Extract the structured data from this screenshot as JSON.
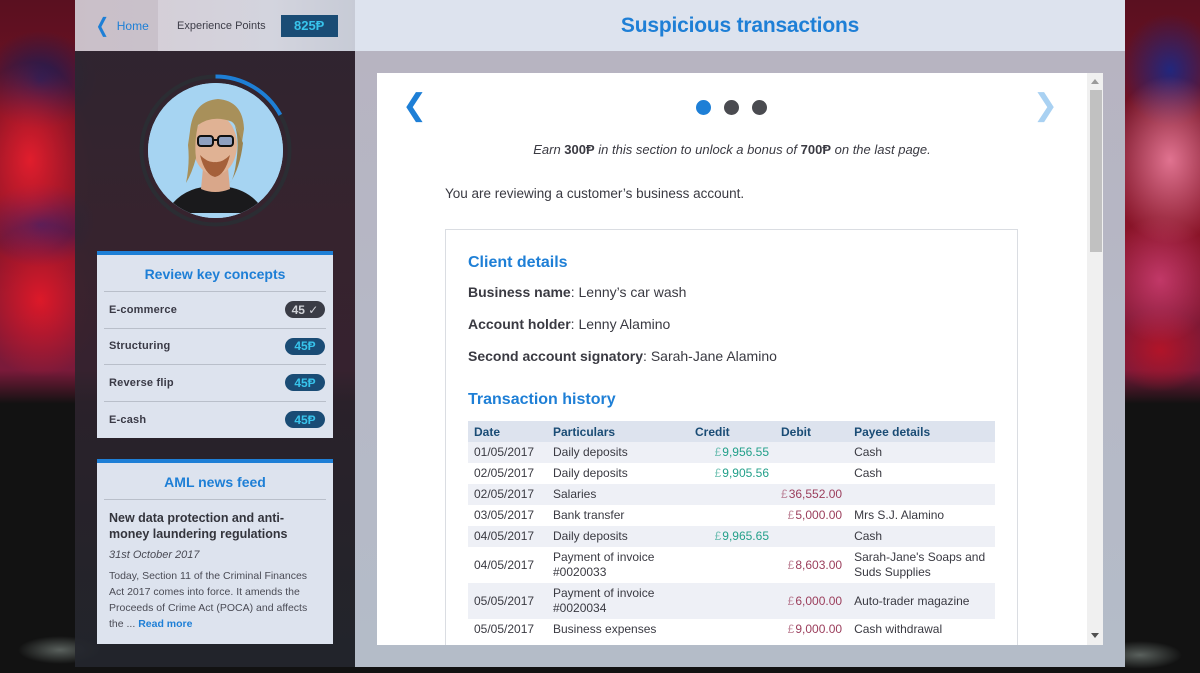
{
  "topbar": {
    "home_label": "Home",
    "xp_label": "Experience Points",
    "xp_value": "825Ᵽ"
  },
  "avatar": {
    "progress_fraction": 0.17,
    "progress_color": "#1e7fd6"
  },
  "key_concepts": {
    "title": "Review key concepts",
    "items": [
      {
        "label": "E-commerce",
        "badge": "45 ✓",
        "completed": true
      },
      {
        "label": "Structuring",
        "badge": "45Ᵽ",
        "completed": false
      },
      {
        "label": "Reverse flip",
        "badge": "45Ᵽ",
        "completed": false
      },
      {
        "label": "E-cash",
        "badge": "45Ᵽ",
        "completed": false
      }
    ]
  },
  "news_feed": {
    "title": "AML news feed",
    "article_title": "New data protection and anti-money laundering regulations",
    "date": "31st October 2017",
    "excerpt": "Today, Section 11 of the Criminal Finances Act 2017 comes into force. It amends the Proceeds of Crime Act (POCA) and affects the ... ",
    "read_more": "Read more"
  },
  "main": {
    "title": "Suspicious transactions",
    "pagination": {
      "total": 3,
      "current": 1
    },
    "earn_prefix": "Earn ",
    "earn_amount": "300Ᵽ",
    "earn_middle": " in this section to unlock a bonus of ",
    "bonus_amount": "700Ᵽ",
    "earn_suffix": " on the last page.",
    "intro": "You are reviewing a customer’s business account."
  },
  "client_details": {
    "heading": "Client details",
    "business_name_label": "Business name",
    "business_name": "Lenny’s car wash",
    "account_holder_label": "Account holder",
    "account_holder": "Lenny Alamino",
    "second_signatory_label": "Second account signatory",
    "second_signatory": "Sarah-Jane Alamino"
  },
  "transactions": {
    "heading": "Transaction history",
    "currency_symbol": "£",
    "columns": [
      "Date",
      "Particulars",
      "Credit",
      "Debit",
      "Payee details"
    ],
    "rows": [
      {
        "date": "01/05/2017",
        "particulars": "Daily deposits",
        "credit": "9,956.55",
        "debit": "",
        "payee": "Cash"
      },
      {
        "date": "02/05/2017",
        "particulars": "Daily deposits",
        "credit": "9,905.56",
        "debit": "",
        "payee": "Cash"
      },
      {
        "date": "02/05/2017",
        "particulars": "Salaries",
        "credit": "",
        "debit": "36,552.00",
        "payee": ""
      },
      {
        "date": "03/05/2017",
        "particulars": "Bank transfer",
        "credit": "",
        "debit": "5,000.00",
        "payee": "Mrs S.J. Alamino"
      },
      {
        "date": "04/05/2017",
        "particulars": "Daily deposits",
        "credit": "9,965.65",
        "debit": "",
        "payee": "Cash"
      },
      {
        "date": "04/05/2017",
        "particulars": "Payment of invoice #0020033",
        "credit": "",
        "debit": "8,603.00",
        "payee": "Sarah-Jane's Soaps and Suds Supplies"
      },
      {
        "date": "05/05/2017",
        "particulars": "Payment of invoice #0020034",
        "credit": "",
        "debit": "6,000.00",
        "payee": "Auto-trader magazine"
      },
      {
        "date": "05/05/2017",
        "particulars": "Business expenses",
        "credit": "",
        "debit": "9,000.00",
        "payee": "Cash withdrawal"
      }
    ]
  }
}
